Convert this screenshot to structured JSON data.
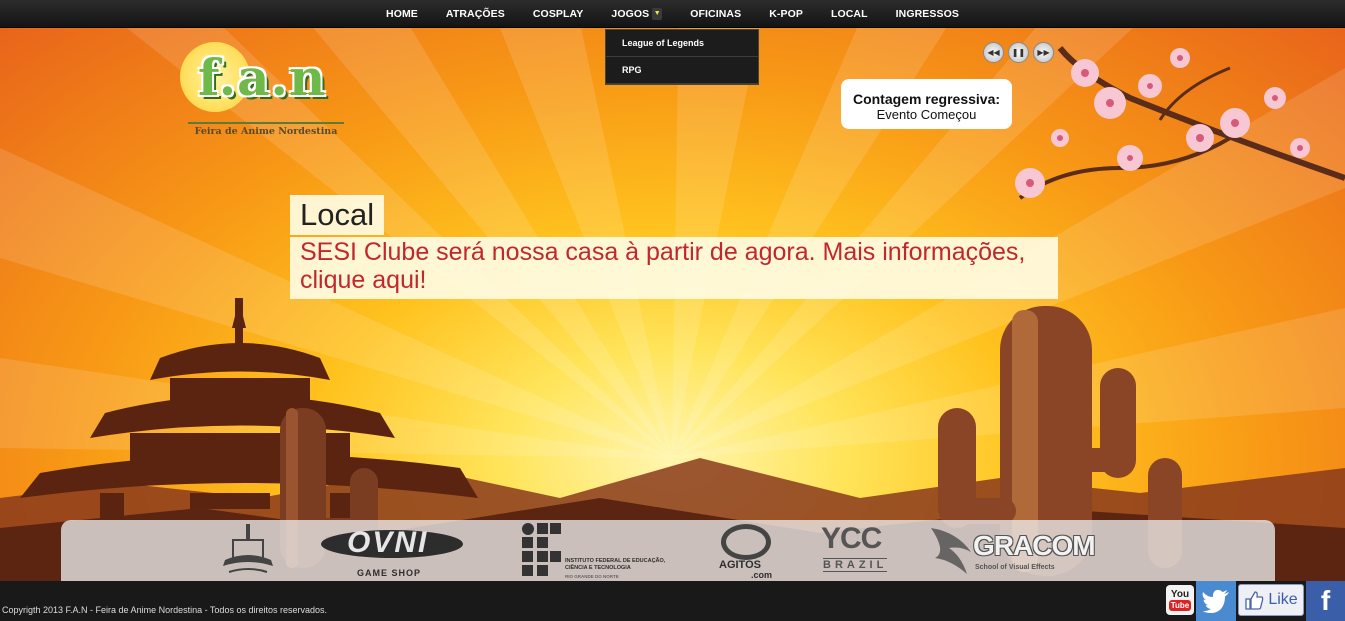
{
  "nav": {
    "items": [
      "HOME",
      "ATRAÇÕES",
      "COSPLAY",
      "JOGOS",
      "OFICINAS",
      "K-POP",
      "LOCAL",
      "INGRESSOS"
    ],
    "dropdown": [
      "League of Legends",
      "RPG"
    ]
  },
  "logo": {
    "title": "f.a.n",
    "subtitle": "Feira de Anime Nordestina"
  },
  "countdown": {
    "label": "Contagem regressiva:",
    "value": "Evento Começou"
  },
  "slide": {
    "title": "Local",
    "text": "SESI Clube será nossa casa à partir de agora. Mais informações, clique aqui!"
  },
  "sponsors": {
    "ovni": "OVNI",
    "ovni_sub": "GAME SHOP",
    "ifrn": "INSTITUTO FEDERAL DE EDUCAÇÃO, CIÊNCIA E TECNOLOGIA",
    "ifrn_sub": "RIO GRANDE DO NORTE",
    "agitos": "AGITOS",
    "agitos_sub": ".com",
    "ycc": "YCC",
    "ycc_sub": "BRAZIL",
    "gracom": "GRACOM",
    "gracom_sub": "School of Visual Effects"
  },
  "footer": {
    "copyright": "Copyrigth 2013 F.A.N - Feira de Anime Nordestina - Todos os direitos reservados.",
    "youtube_a": "You",
    "youtube_b": "Tube",
    "like": "Like",
    "facebook": "f"
  },
  "colors": {
    "accent_red": "#c0282e",
    "nav_bg": "#1e1e1e",
    "twitter": "#4a8ad0",
    "facebook": "#3b5ea8"
  }
}
